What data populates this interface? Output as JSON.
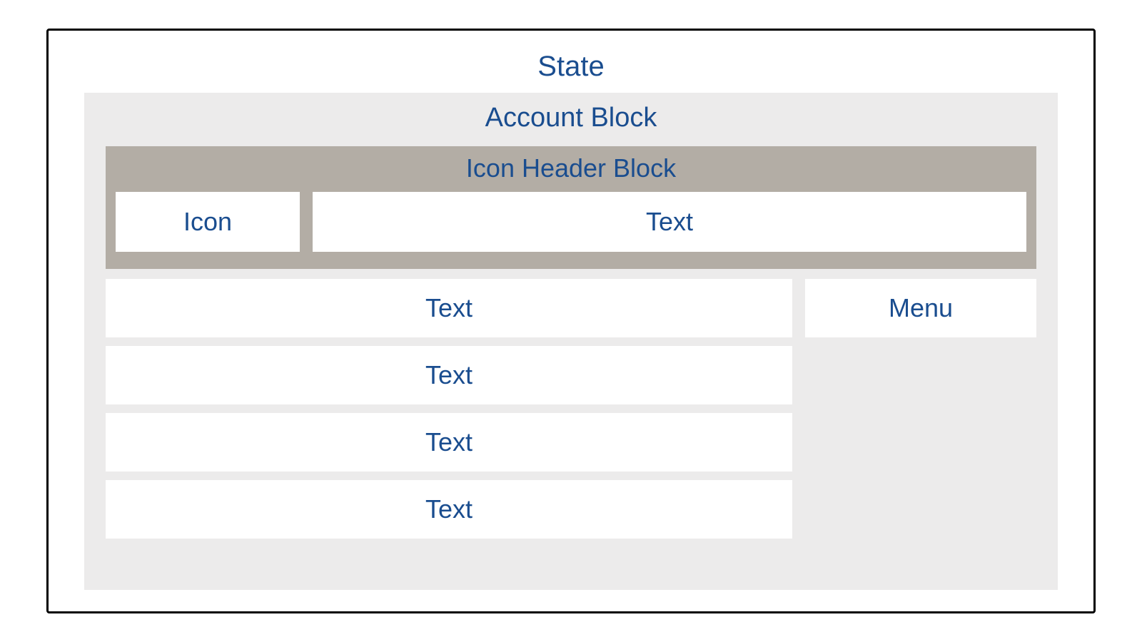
{
  "title": "State",
  "account_block": {
    "title": "Account Block",
    "icon_header": {
      "title": "Icon Header Block",
      "icon_label": "Icon",
      "text_label": "Text"
    },
    "rows": [
      {
        "text": "Text",
        "menu": "Menu"
      },
      {
        "text": "Text"
      },
      {
        "text": "Text"
      },
      {
        "text": "Text"
      }
    ]
  }
}
